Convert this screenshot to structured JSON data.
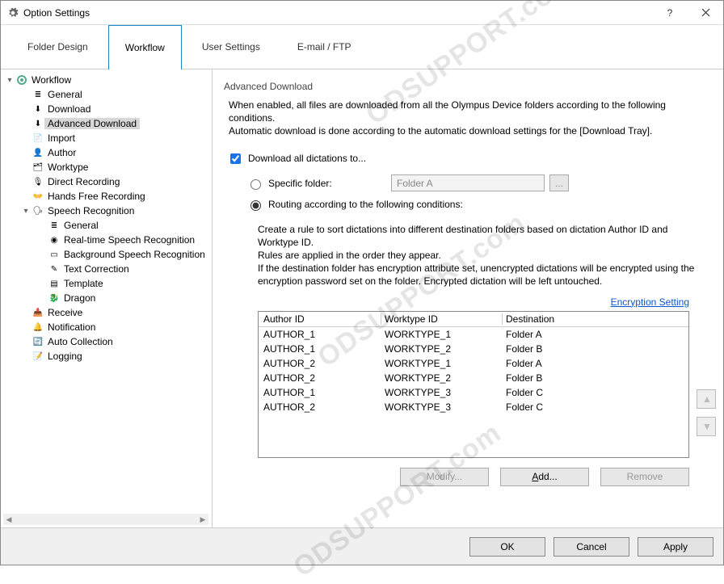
{
  "window": {
    "title": "Option Settings"
  },
  "tabs": [
    "Folder Design",
    "Workflow",
    "User Settings",
    "E-mail / FTP"
  ],
  "active_tab": 1,
  "tree": {
    "root": "Workflow",
    "items": [
      "General",
      "Download",
      "Advanced Download",
      "Import",
      "Author",
      "Worktype",
      "Direct Recording",
      "Hands Free Recording",
      "Speech Recognition",
      "Receive",
      "Notification",
      "Auto Collection",
      "Logging"
    ],
    "speech_children": [
      "General",
      "Real-time Speech Recognition",
      "Background Speech Recognition",
      "Text Correction",
      "Template",
      "Dragon"
    ],
    "selected": "Advanced Download"
  },
  "panel": {
    "heading": "Advanced Download",
    "desc1": "When enabled, all files are downloaded from all the Olympus Device folders according to the following conditions.",
    "desc2": "Automatic download is done according to the automatic download settings for the [Download Tray].",
    "chk_label": "Download all dictations to...",
    "chk_checked": true,
    "radio_specific": "Specific folder:",
    "specific_value": "Folder A",
    "radio_routing": "Routing according to the following conditions:",
    "radio_selected": "routing",
    "rules_desc1": "Create a rule to sort dictations into different destination folders based on dictation Author ID and Worktype ID.",
    "rules_desc2": "Rules are applied in the order they appear.",
    "rules_desc3": "If the destination folder has encryption attribute set, unencrypted dictations will be encrypted using the encryption password set on the folder. Encrypted dictation will be left untouched.",
    "enc_link": "Encryption Setting",
    "table": {
      "headers": [
        "Author ID",
        "Worktype ID",
        "Destination"
      ],
      "rows": [
        [
          "AUTHOR_1",
          "WORKTYPE_1",
          "Folder A"
        ],
        [
          "AUTHOR_1",
          "WORKTYPE_2",
          "Folder B"
        ],
        [
          "AUTHOR_2",
          "WORKTYPE_1",
          "Folder A"
        ],
        [
          "AUTHOR_2",
          "WORKTYPE_2",
          "Folder B"
        ],
        [
          "AUTHOR_1",
          "WORKTYPE_3",
          "Folder C"
        ],
        [
          "AUTHOR_2",
          "WORKTYPE_3",
          "Folder C"
        ]
      ]
    },
    "btn_modify": "Modify...",
    "btn_add": "Add...",
    "btn_remove": "Remove"
  },
  "footer": {
    "ok": "OK",
    "cancel": "Cancel",
    "apply": "Apply"
  },
  "watermark": "ODSUPPORT.com"
}
